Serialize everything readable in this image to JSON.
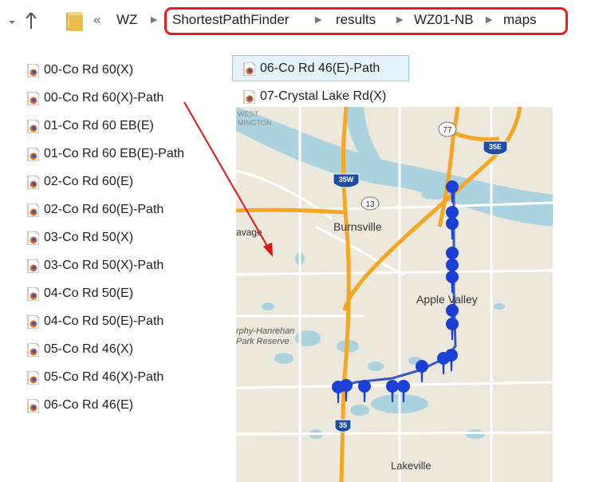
{
  "address_bar": {
    "overflow_glyph": "«",
    "breadcrumbs": [
      "WZ",
      "ShortestPathFinder",
      "results",
      "WZ01-NB",
      "maps"
    ]
  },
  "files_col1": [
    "00-Co Rd 60(X)",
    "00-Co Rd 60(X)-Path",
    "01-Co Rd 60 EB(E)",
    "01-Co Rd 60 EB(E)-Path",
    "02-Co Rd 60(E)",
    "02-Co Rd 60(E)-Path",
    "03-Co Rd 50(X)",
    "03-Co Rd 50(X)-Path",
    "04-Co Rd 50(E)",
    "04-Co Rd 50(E)-Path",
    "05-Co Rd 46(X)",
    "05-Co Rd 46(X)-Path",
    "06-Co Rd 46(E)"
  ],
  "files_col2": [
    "06-Co Rd 46(E)-Path",
    "07-Crystal Lake Rd(X)"
  ],
  "map": {
    "labels": {
      "west_bloomington_1": "WEST",
      "west_bloomington_2": "MINGTON",
      "burnsville": "Burnsville",
      "savage": "avage",
      "apple_valley": "Apple Valley",
      "murphy_1": "rphy-Hanrehan",
      "murphy_2": "Park Reserve",
      "lakeville": "Lakeville"
    },
    "shields": {
      "i35w": "35W",
      "i35e": "35E",
      "i35": "35",
      "hwy77": "77",
      "hwy13": "13"
    },
    "colors": {
      "land": "#ece8dc",
      "water": "#aad3df",
      "highway": "#f5a623",
      "road": "#ffffff",
      "marker": "#1a3fd6"
    }
  },
  "colors": {
    "highlight_border": "#ee1b1b",
    "arrow": "#e31414",
    "selection_fill": "#e5f1fb"
  }
}
